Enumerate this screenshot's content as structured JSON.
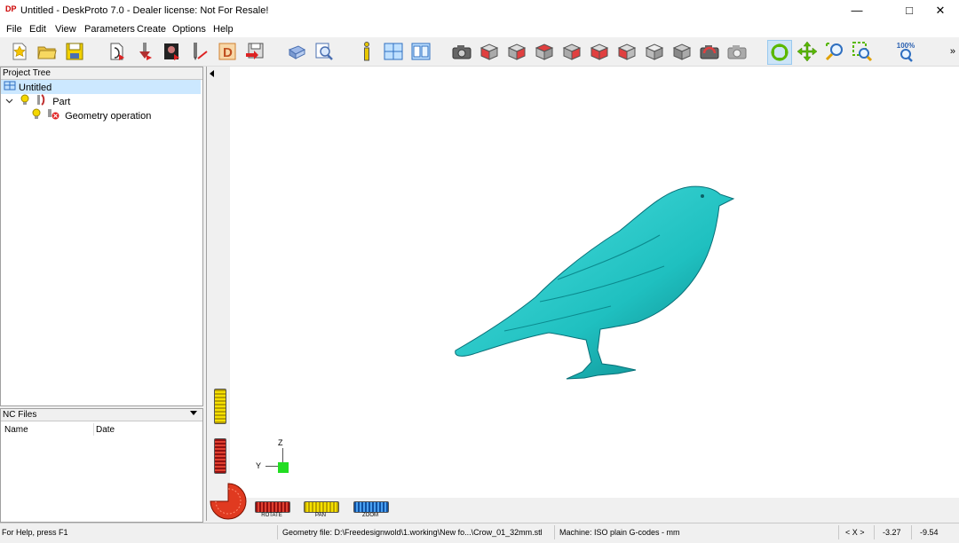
{
  "window": {
    "app_logo": "DP",
    "title": "Untitled - DeskProto 7.0 - Dealer license: Not For Resale!"
  },
  "menu": [
    "File",
    "Edit",
    "View",
    "Parameters",
    "Create",
    "Options",
    "Help"
  ],
  "toolbar": {
    "zoom_label": "100%",
    "overflow": "»"
  },
  "project_tree": {
    "header": "Project Tree",
    "items": [
      {
        "label": "Untitled",
        "selected": true
      },
      {
        "label": "Part",
        "expanded": true
      },
      {
        "label": "Geometry operation"
      }
    ]
  },
  "nc_files": {
    "header": "NC Files",
    "columns": [
      "Name",
      "Date"
    ]
  },
  "viewport": {
    "axis_z": "Z",
    "axis_y": "Y",
    "model_color": "#1fc0c0",
    "sliders": {
      "rotate": "ROTATE",
      "pan": "PAN",
      "zoom": "ZOOM"
    }
  },
  "status": {
    "help": "For Help, press F1",
    "geometry": "Geometry file: D:\\Freedesignwold\\1.working\\New fo...\\Crow_01_32mm.stl",
    "machine": "Machine: ISO plain G-codes - mm",
    "axis": "< X >",
    "x": "-3.27",
    "y": "-9.54"
  }
}
